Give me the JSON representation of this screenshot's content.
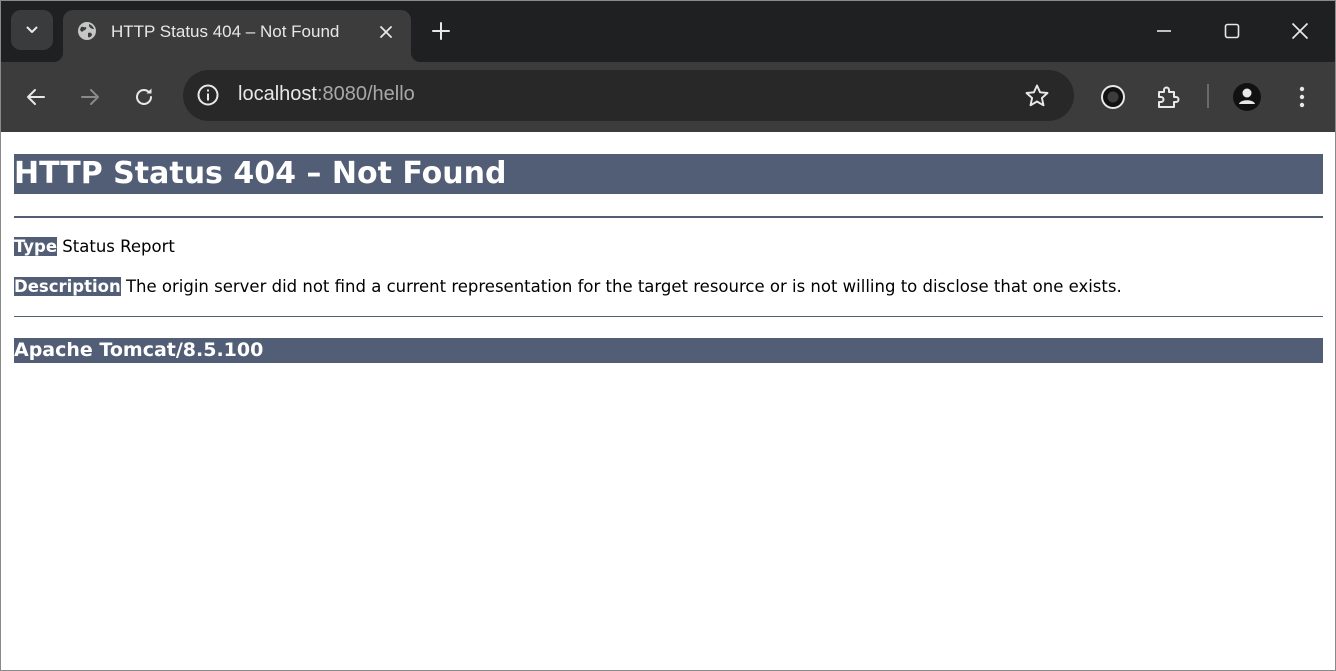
{
  "browser": {
    "tab": {
      "title": "HTTP Status 404 – Not Found",
      "favicon": "globe-icon"
    },
    "address_bar": {
      "host": "localhost",
      "path": ":8080/hello"
    },
    "icons": {
      "tab_search": "chevron-down-icon",
      "tab_close": "close-icon",
      "new_tab": "plus-icon",
      "minimize": "minimize-icon",
      "maximize": "maximize-icon",
      "close_window": "close-icon",
      "back": "arrow-left-icon",
      "forward": "arrow-right-icon",
      "reload": "reload-icon",
      "site_info": "info-icon",
      "bookmark": "star-icon",
      "extension_ring": "ring-icon",
      "extensions": "puzzle-icon",
      "profile": "person-icon",
      "menu": "kebab-menu-icon"
    },
    "colors": {
      "tabstrip_bg": "#1f2022",
      "toolbar_bg": "#3c3c3c",
      "omnibox_bg": "#282828"
    }
  },
  "page": {
    "heading": "HTTP Status 404 – Not Found",
    "type_label": "Type",
    "type_value": " Status Report",
    "description_label": "Description",
    "description_value": " The origin server did not find a current representation for the target resource or is not willing to disclose that one exists.",
    "server_info": "Apache Tomcat/8.5.100",
    "colors": {
      "accent": "#525d76",
      "heading_text": "#ffffff"
    }
  }
}
